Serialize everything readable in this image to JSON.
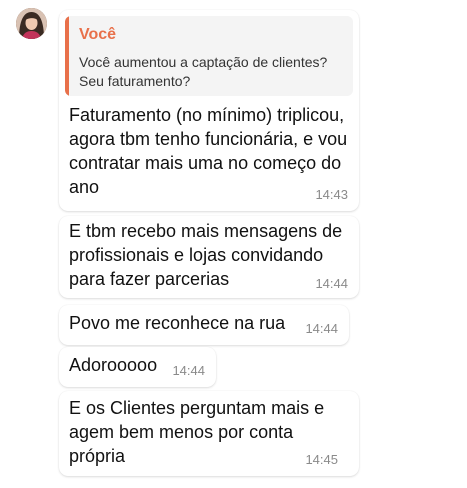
{
  "quoted": {
    "author": "Você",
    "text": "Você aumentou a captação de clientes?\nSeu faturamento?"
  },
  "messages": [
    {
      "text": "Faturamento (no mínimo) triplicou,\nagora tbm tenho funcionária, e vou\ncontratar mais uma no começo do\nano",
      "time": "14:43"
    },
    {
      "text": "E tbm recebo mais mensagens de\nprofissionais e lojas convidando\npara fazer parcerias",
      "time": "14:44"
    },
    {
      "text": "Povo me reconhece na rua",
      "time": "14:44"
    },
    {
      "text": "Adorooooo",
      "time": "14:44"
    },
    {
      "text": "E os Clientes perguntam mais e\nagem bem menos por conta\nprópria",
      "time": "14:45"
    }
  ],
  "colors": {
    "quote_accent": "#e8704a",
    "bubble_bg": "#ffffff",
    "timestamp": "#8a8a8a"
  }
}
